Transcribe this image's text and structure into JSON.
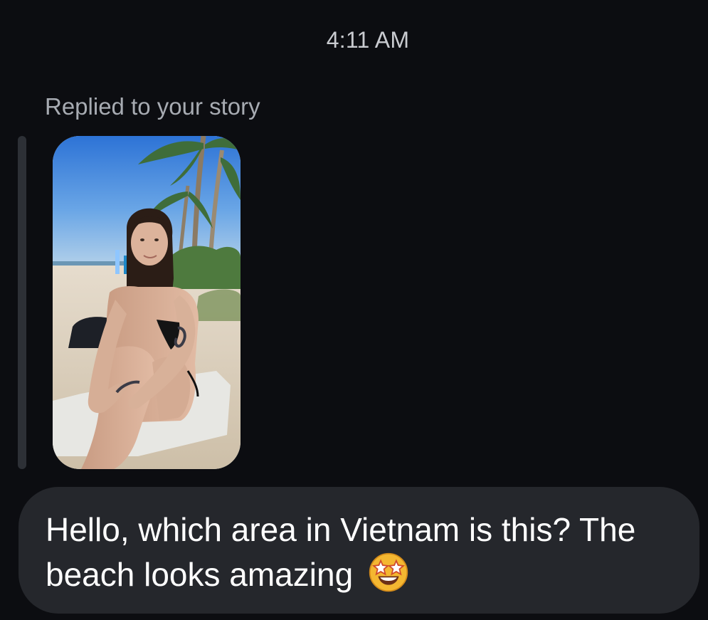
{
  "timestamp": "4:11 AM",
  "reply_label": "Replied to your story",
  "story": {
    "image": "beach-photo-woman-sitting-on-towel"
  },
  "message": {
    "text": "Hello, which area in Vietnam is this? The beach looks amazing",
    "emoji": "star-struck-emoji"
  },
  "colors": {
    "background": "#0c0d11",
    "bubble": "#25272c",
    "reply_bar": "#2d3036",
    "label_text": "#a7abb2"
  }
}
